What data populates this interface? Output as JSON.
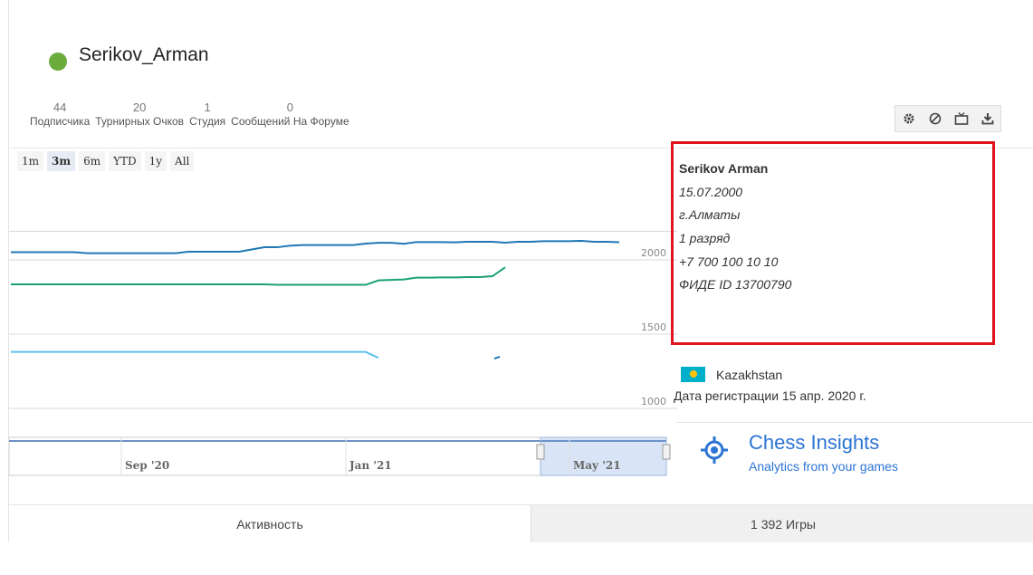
{
  "profile": {
    "username": "Serikov_Arman",
    "status_color": "#6bac3c"
  },
  "stats": [
    {
      "num": "44",
      "label": "Подписчика"
    },
    {
      "num": "20",
      "label": "Турнирных Очков"
    },
    {
      "num": "1",
      "label": "Студия"
    },
    {
      "num": "0",
      "label": "Сообщений На Форуме"
    }
  ],
  "toolbar": {
    "icons": [
      "gear-icon",
      "block-icon",
      "tv-icon",
      "download-icon"
    ]
  },
  "ranges": [
    "1m",
    "3m",
    "6m",
    "YTD",
    "1y",
    "All"
  ],
  "active_range": "3m",
  "bio": {
    "name": "Serikov Arman",
    "birthdate": "15.07.2000",
    "city": "г.Алматы",
    "rank": "1 разряд",
    "phone": "+7 700 100 10 10",
    "fide": "ФИДЕ ID 13700790"
  },
  "country": "Kazakhstan",
  "registration": "Дата регистрации 15 апр. 2020 г.",
  "insights": {
    "title": "Chess Insights",
    "subtitle": "Analytics from your games"
  },
  "tabs": [
    "Активность",
    "1 392 Игры"
  ],
  "chart_data": {
    "type": "line",
    "y_ticks": [
      "2000",
      "1500",
      "1000"
    ],
    "navigator_labels": [
      "Sep '20",
      "Jan '21",
      "May '21"
    ],
    "series": [
      {
        "color": "#1f77b4",
        "values": [
          2052,
          2052,
          2052,
          2052,
          2052,
          2052,
          2045,
          2045,
          2045,
          2045,
          2045,
          2045,
          2045,
          2045,
          2055,
          2055,
          2055,
          2055,
          2055,
          2070,
          2085,
          2085,
          2095,
          2100,
          2100,
          2100,
          2100,
          2100,
          2110,
          2115,
          2115,
          2108,
          2120,
          2120,
          2120,
          2118,
          2122,
          2122,
          2122,
          2116,
          2122,
          2122,
          2126,
          2126,
          2126,
          2128,
          2122,
          2122,
          2119
        ]
      },
      {
        "color": "#1aa079",
        "values": [
          1835,
          1835,
          1835,
          1835,
          1835,
          1835,
          1835,
          1835,
          1835,
          1835,
          1835,
          1835,
          1835,
          1835,
          1835,
          1835,
          1835,
          1835,
          1835,
          1835,
          1835,
          1832,
          1832,
          1832,
          1832,
          1832,
          1832,
          1832,
          1832,
          1862,
          1865,
          1868,
          1880,
          1880,
          1882,
          1882,
          1884,
          1884,
          1890,
          1950
        ]
      },
      {
        "color": "#5bc0eb",
        "values": [
          1380,
          1380,
          1380,
          1380,
          1380,
          1380,
          1380,
          1380,
          1380,
          1380,
          1380,
          1380,
          1380,
          1380,
          1380,
          1380,
          1380,
          1380,
          1380,
          1380,
          1380,
          1380,
          1380,
          1380,
          1380,
          1380,
          1380,
          1380,
          1380,
          1340
        ]
      }
    ]
  }
}
